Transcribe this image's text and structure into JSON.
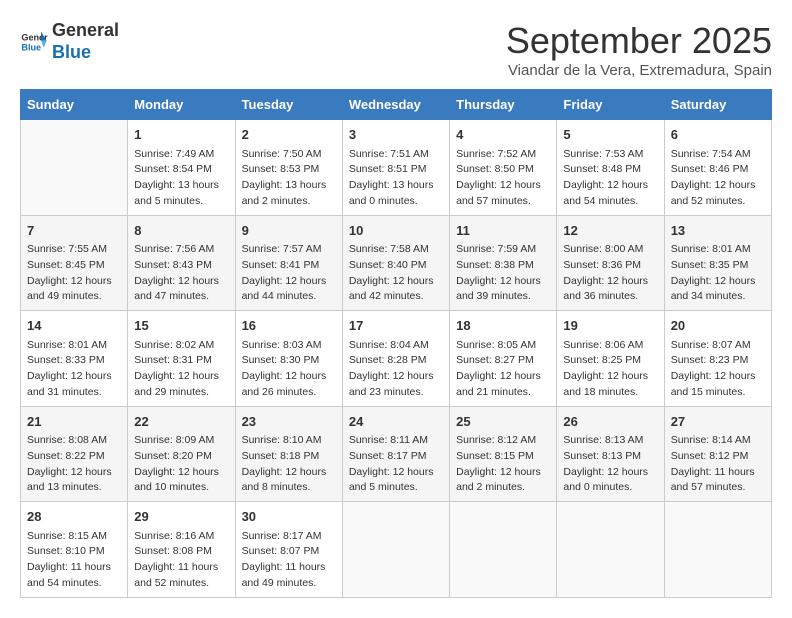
{
  "header": {
    "logo_line1": "General",
    "logo_line2": "Blue",
    "month": "September 2025",
    "location": "Viandar de la Vera, Extremadura, Spain"
  },
  "days_of_week": [
    "Sunday",
    "Monday",
    "Tuesday",
    "Wednesday",
    "Thursday",
    "Friday",
    "Saturday"
  ],
  "weeks": [
    [
      {
        "num": "",
        "info": ""
      },
      {
        "num": "1",
        "info": "Sunrise: 7:49 AM\nSunset: 8:54 PM\nDaylight: 13 hours\nand 5 minutes."
      },
      {
        "num": "2",
        "info": "Sunrise: 7:50 AM\nSunset: 8:53 PM\nDaylight: 13 hours\nand 2 minutes."
      },
      {
        "num": "3",
        "info": "Sunrise: 7:51 AM\nSunset: 8:51 PM\nDaylight: 13 hours\nand 0 minutes."
      },
      {
        "num": "4",
        "info": "Sunrise: 7:52 AM\nSunset: 8:50 PM\nDaylight: 12 hours\nand 57 minutes."
      },
      {
        "num": "5",
        "info": "Sunrise: 7:53 AM\nSunset: 8:48 PM\nDaylight: 12 hours\nand 54 minutes."
      },
      {
        "num": "6",
        "info": "Sunrise: 7:54 AM\nSunset: 8:46 PM\nDaylight: 12 hours\nand 52 minutes."
      }
    ],
    [
      {
        "num": "7",
        "info": "Sunrise: 7:55 AM\nSunset: 8:45 PM\nDaylight: 12 hours\nand 49 minutes."
      },
      {
        "num": "8",
        "info": "Sunrise: 7:56 AM\nSunset: 8:43 PM\nDaylight: 12 hours\nand 47 minutes."
      },
      {
        "num": "9",
        "info": "Sunrise: 7:57 AM\nSunset: 8:41 PM\nDaylight: 12 hours\nand 44 minutes."
      },
      {
        "num": "10",
        "info": "Sunrise: 7:58 AM\nSunset: 8:40 PM\nDaylight: 12 hours\nand 42 minutes."
      },
      {
        "num": "11",
        "info": "Sunrise: 7:59 AM\nSunset: 8:38 PM\nDaylight: 12 hours\nand 39 minutes."
      },
      {
        "num": "12",
        "info": "Sunrise: 8:00 AM\nSunset: 8:36 PM\nDaylight: 12 hours\nand 36 minutes."
      },
      {
        "num": "13",
        "info": "Sunrise: 8:01 AM\nSunset: 8:35 PM\nDaylight: 12 hours\nand 34 minutes."
      }
    ],
    [
      {
        "num": "14",
        "info": "Sunrise: 8:01 AM\nSunset: 8:33 PM\nDaylight: 12 hours\nand 31 minutes."
      },
      {
        "num": "15",
        "info": "Sunrise: 8:02 AM\nSunset: 8:31 PM\nDaylight: 12 hours\nand 29 minutes."
      },
      {
        "num": "16",
        "info": "Sunrise: 8:03 AM\nSunset: 8:30 PM\nDaylight: 12 hours\nand 26 minutes."
      },
      {
        "num": "17",
        "info": "Sunrise: 8:04 AM\nSunset: 8:28 PM\nDaylight: 12 hours\nand 23 minutes."
      },
      {
        "num": "18",
        "info": "Sunrise: 8:05 AM\nSunset: 8:27 PM\nDaylight: 12 hours\nand 21 minutes."
      },
      {
        "num": "19",
        "info": "Sunrise: 8:06 AM\nSunset: 8:25 PM\nDaylight: 12 hours\nand 18 minutes."
      },
      {
        "num": "20",
        "info": "Sunrise: 8:07 AM\nSunset: 8:23 PM\nDaylight: 12 hours\nand 15 minutes."
      }
    ],
    [
      {
        "num": "21",
        "info": "Sunrise: 8:08 AM\nSunset: 8:22 PM\nDaylight: 12 hours\nand 13 minutes."
      },
      {
        "num": "22",
        "info": "Sunrise: 8:09 AM\nSunset: 8:20 PM\nDaylight: 12 hours\nand 10 minutes."
      },
      {
        "num": "23",
        "info": "Sunrise: 8:10 AM\nSunset: 8:18 PM\nDaylight: 12 hours\nand 8 minutes."
      },
      {
        "num": "24",
        "info": "Sunrise: 8:11 AM\nSunset: 8:17 PM\nDaylight: 12 hours\nand 5 minutes."
      },
      {
        "num": "25",
        "info": "Sunrise: 8:12 AM\nSunset: 8:15 PM\nDaylight: 12 hours\nand 2 minutes."
      },
      {
        "num": "26",
        "info": "Sunrise: 8:13 AM\nSunset: 8:13 PM\nDaylight: 12 hours\nand 0 minutes."
      },
      {
        "num": "27",
        "info": "Sunrise: 8:14 AM\nSunset: 8:12 PM\nDaylight: 11 hours\nand 57 minutes."
      }
    ],
    [
      {
        "num": "28",
        "info": "Sunrise: 8:15 AM\nSunset: 8:10 PM\nDaylight: 11 hours\nand 54 minutes."
      },
      {
        "num": "29",
        "info": "Sunrise: 8:16 AM\nSunset: 8:08 PM\nDaylight: 11 hours\nand 52 minutes."
      },
      {
        "num": "30",
        "info": "Sunrise: 8:17 AM\nSunset: 8:07 PM\nDaylight: 11 hours\nand 49 minutes."
      },
      {
        "num": "",
        "info": ""
      },
      {
        "num": "",
        "info": ""
      },
      {
        "num": "",
        "info": ""
      },
      {
        "num": "",
        "info": ""
      }
    ]
  ]
}
